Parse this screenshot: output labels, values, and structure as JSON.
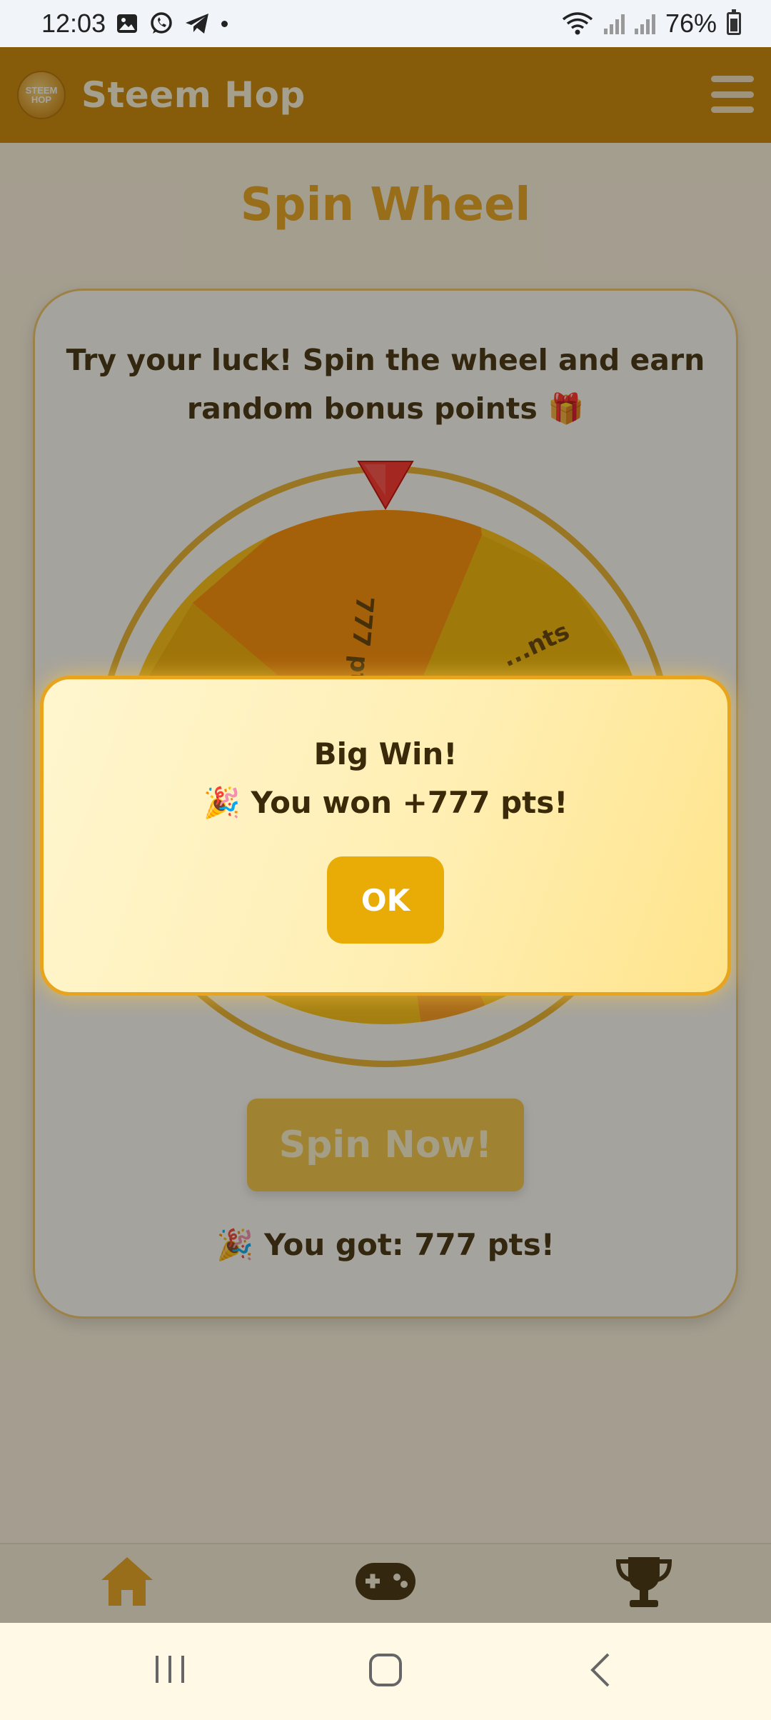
{
  "status_bar": {
    "time": "12:03",
    "notification_icons": [
      "gallery-icon",
      "whatsapp-icon",
      "telegram-icon"
    ],
    "battery": "76%"
  },
  "header": {
    "logo_text": "STEEM HOP",
    "title": "Steem Hop"
  },
  "page": {
    "title": "Spin Wheel",
    "intro": "Try your luck! Spin the wheel and earn random bonus points 🎁",
    "spin_button": "Spin Now!",
    "result": "🎉 You got: 777 pts!"
  },
  "wheel": {
    "segments": [
      "777 pts",
      "...nts"
    ],
    "colors": [
      "#ff8c00",
      "#f5b800",
      "#ffc20e"
    ]
  },
  "dialog": {
    "title": "Big Win!",
    "message": "🎉 You won +777 pts!",
    "ok_button": "OK"
  },
  "bottom_nav": {
    "items": [
      {
        "icon": "home-icon",
        "active": true
      },
      {
        "icon": "gamepad-icon",
        "active": false
      },
      {
        "icon": "trophy-icon",
        "active": false
      }
    ]
  },
  "colors": {
    "brand": "#ca8500",
    "accent": "#e9ab06",
    "text_dark": "#3b2a0a",
    "title_orange": "#e8a41d"
  }
}
